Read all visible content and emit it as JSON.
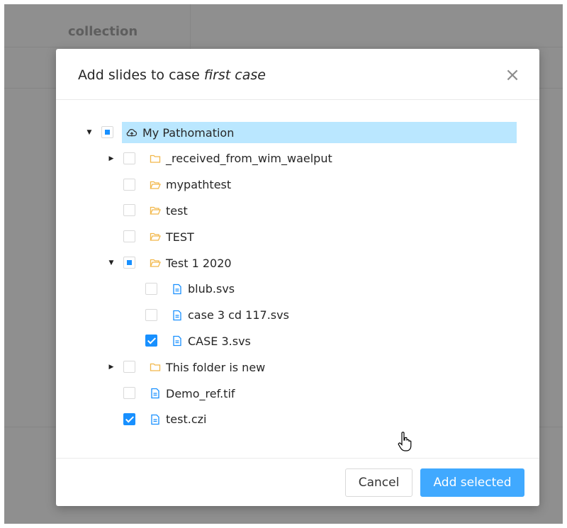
{
  "background": {
    "column_label": "collection"
  },
  "dialog": {
    "title_prefix": "Add slides to case ",
    "title_case": "first case",
    "close_glyph": "×"
  },
  "tree": [
    {
      "label": "My Pathomation",
      "icon": "cloud-icon",
      "state": "indeterminate",
      "expander": "expanded",
      "selected": true,
      "level": 0
    },
    {
      "label": "_received_from_wim_waelput",
      "icon": "folder-icon",
      "state": "unchecked",
      "expander": "collapsed",
      "selected": false,
      "level": 1
    },
    {
      "label": "mypathtest",
      "icon": "folder-open-icon",
      "state": "unchecked",
      "expander": "none",
      "selected": false,
      "level": 1
    },
    {
      "label": "test",
      "icon": "folder-open-icon",
      "state": "unchecked",
      "expander": "none",
      "selected": false,
      "level": 1
    },
    {
      "label": "TEST",
      "icon": "folder-open-icon",
      "state": "unchecked",
      "expander": "none",
      "selected": false,
      "level": 1
    },
    {
      "label": "Test 1 2020",
      "icon": "folder-open-icon",
      "state": "indeterminate",
      "expander": "expanded",
      "selected": false,
      "level": 1
    },
    {
      "label": "blub.svs",
      "icon": "file-icon",
      "state": "unchecked",
      "expander": "none",
      "selected": false,
      "level": 2
    },
    {
      "label": "case 3 cd 117.svs",
      "icon": "file-icon",
      "state": "unchecked",
      "expander": "none",
      "selected": false,
      "level": 2
    },
    {
      "label": "CASE 3.svs",
      "icon": "file-icon",
      "state": "checked",
      "expander": "none",
      "selected": false,
      "level": 2
    },
    {
      "label": "This folder is new",
      "icon": "folder-icon",
      "state": "unchecked",
      "expander": "collapsed",
      "selected": false,
      "level": 1
    },
    {
      "label": "Demo_ref.tif",
      "icon": "file-icon",
      "state": "unchecked",
      "expander": "none",
      "selected": false,
      "level": 1
    },
    {
      "label": "test.czi",
      "icon": "file-icon",
      "state": "checked",
      "expander": "none",
      "selected": false,
      "level": 1
    }
  ],
  "footer": {
    "cancel_label": "Cancel",
    "add_label": "Add selected"
  },
  "colors": {
    "accent": "#1890ff",
    "primary_button": "#40a9ff",
    "selected_node": "#bae7ff",
    "folder": "#f2b84b",
    "file": "#1890ff"
  }
}
